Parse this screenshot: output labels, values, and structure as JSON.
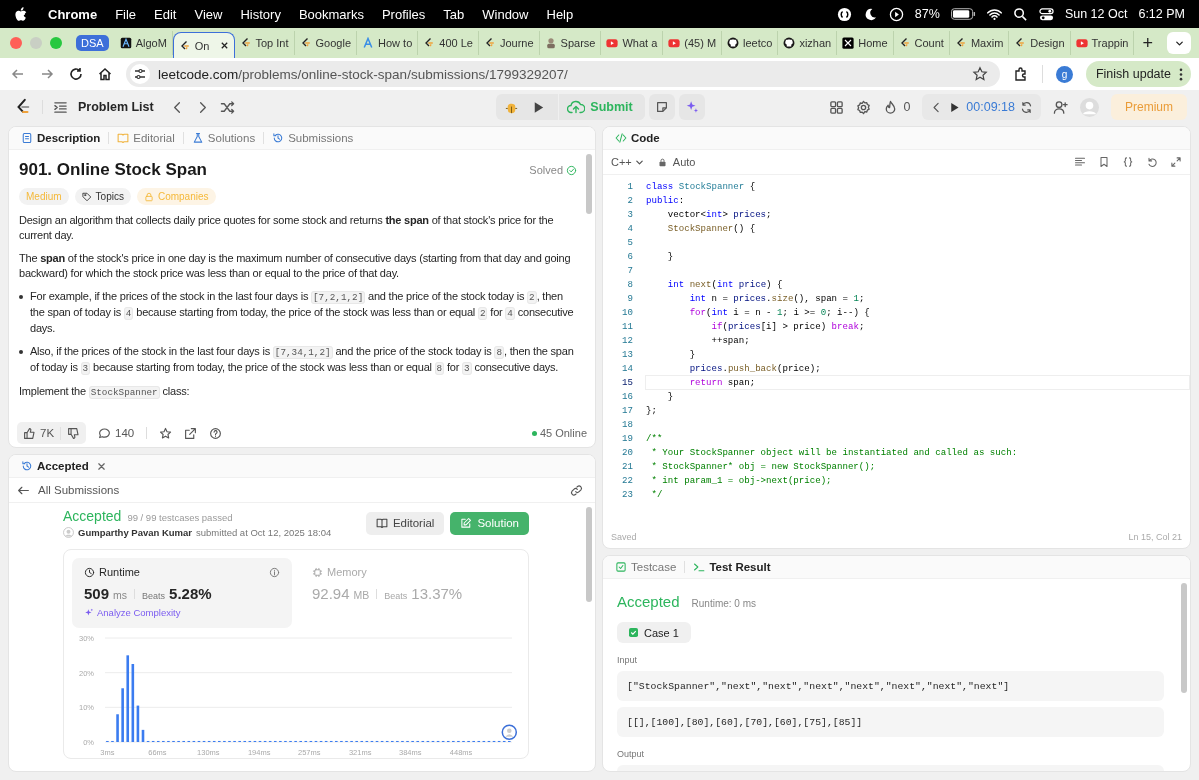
{
  "menu_bar": {
    "app": "Chrome",
    "items": [
      "File",
      "Edit",
      "View",
      "History",
      "Bookmarks",
      "Profiles",
      "Tab",
      "Window",
      "Help"
    ],
    "battery": "87%",
    "date": "Sun 12 Oct",
    "time": "6:12 PM"
  },
  "browser": {
    "group": "DSA",
    "tabs": [
      {
        "kind": "algo",
        "title": "AlgoM",
        "selected": false
      },
      {
        "kind": "leetcode",
        "title": "On",
        "selected": true
      },
      {
        "kind": "leetcode",
        "title": "Top Int",
        "selected": false
      },
      {
        "kind": "leetcode",
        "title": "Google",
        "selected": false
      },
      {
        "kind": "letter",
        "title": "How to",
        "selected": false
      },
      {
        "kind": "leetcode",
        "title": "400 Le",
        "selected": false
      },
      {
        "kind": "leetcode",
        "title": "Journe",
        "selected": false
      },
      {
        "kind": "person",
        "title": "Sparse",
        "selected": false
      },
      {
        "kind": "video",
        "title": "What a",
        "selected": false
      },
      {
        "kind": "video",
        "title": "(45) M",
        "selected": false
      },
      {
        "kind": "octocat",
        "title": "leetco",
        "selected": false
      },
      {
        "kind": "octocat",
        "title": "xizhan",
        "selected": false
      },
      {
        "kind": "cross",
        "title": "Home",
        "selected": false
      },
      {
        "kind": "leetcode",
        "title": "Count",
        "selected": false
      },
      {
        "kind": "leetcode",
        "title": "Maxim",
        "selected": false
      },
      {
        "kind": "leetcode",
        "title": "Design",
        "selected": false
      },
      {
        "kind": "video",
        "title": "Trappin",
        "selected": false
      }
    ],
    "new_tab": "+",
    "address": {
      "host": "leetcode.com",
      "path": "/problems/online-stock-span/submissions/1799329207/"
    },
    "profile": "g",
    "update_button": "Finish update"
  },
  "header": {
    "problem_list": "Problem List",
    "submit": "Submit",
    "streak": "0",
    "timer": "00:09:18",
    "premium": "Premium"
  },
  "description_panel": {
    "tabs": [
      {
        "label": "Description",
        "selected": true
      },
      {
        "label": "Editorial",
        "selected": false
      },
      {
        "label": "Solutions",
        "selected": false
      },
      {
        "label": "Submissions",
        "selected": false
      }
    ],
    "title": "901. Online Stock Span",
    "status": "Solved",
    "difficulty": "Medium",
    "tags": [
      {
        "kind": "topics",
        "label": "Topics"
      },
      {
        "kind": "locked",
        "label": "Companies"
      }
    ],
    "paragraphs": [
      {
        "kind": "text",
        "segments": [
          {
            "kind": "text",
            "text": "Design an algorithm that collects daily price quotes for some stock and returns **the span** of that stock's price for the current day."
          }
        ]
      },
      {
        "kind": "text",
        "segments": [
          {
            "kind": "text",
            "text": "The **span** of the stock's price in one day is the maximum number of consecutive days (starting from that day and going backward) for which the stock price was less than or equal to the price of that day."
          }
        ]
      },
      {
        "kind": "bullet",
        "segments": [
          {
            "kind": "text",
            "text": "For example, if the prices of the stock in the last four days is "
          },
          {
            "kind": "code",
            "text": "[7,2,1,2]"
          },
          {
            "kind": "text",
            "text": " and the price of the stock today is "
          },
          {
            "kind": "code",
            "text": "2"
          },
          {
            "kind": "text",
            "text": ", then the span of today is "
          },
          {
            "kind": "code",
            "text": "4"
          },
          {
            "kind": "text",
            "text": " because starting from today, the price of the stock was less than or equal "
          },
          {
            "kind": "code",
            "text": "2"
          },
          {
            "kind": "text",
            "text": " for "
          },
          {
            "kind": "code",
            "text": "4"
          },
          {
            "kind": "text",
            "text": " consecutive days."
          }
        ]
      },
      {
        "kind": "bullet",
        "segments": [
          {
            "kind": "text",
            "text": "Also, if the prices of the stock in the last four days is "
          },
          {
            "kind": "code",
            "text": "[7,34,1,2]"
          },
          {
            "kind": "text",
            "text": " and the price of the stock today is "
          },
          {
            "kind": "code",
            "text": "8"
          },
          {
            "kind": "text",
            "text": ", then the span of today is "
          },
          {
            "kind": "code",
            "text": "3"
          },
          {
            "kind": "text",
            "text": " because starting from today, the price of the stock was less than or equal "
          },
          {
            "kind": "code",
            "text": "8"
          },
          {
            "kind": "text",
            "text": " for "
          },
          {
            "kind": "code",
            "text": "3"
          },
          {
            "kind": "text",
            "text": " consecutive days."
          }
        ]
      },
      {
        "kind": "text",
        "segments": [
          {
            "kind": "text",
            "text": "Implement the "
          },
          {
            "kind": "code",
            "text": "StockSpanner"
          },
          {
            "kind": "text",
            "text": " class:"
          }
        ]
      }
    ],
    "likes": "7K",
    "comments": "140",
    "online": "45 Online"
  },
  "submission_panel": {
    "tab": "Accepted",
    "back_link": "All Submissions",
    "status": "Accepted",
    "testcases": "99 / 99 testcases passed",
    "author": "Gumparthy Pavan Kumar",
    "submitted": "submitted at Oct 12, 2025 18:04",
    "buttons": [
      {
        "kind": "secondary",
        "label": "Editorial"
      },
      {
        "kind": "primary",
        "label": "Solution"
      }
    ],
    "stats": [
      {
        "kind": "runtime",
        "label": "Runtime",
        "value": "509",
        "unit": "ms",
        "beats_label": "Beats",
        "beats": "5.28%",
        "action": "Analyze Complexity",
        "selected": true
      },
      {
        "kind": "memory",
        "label": "Memory",
        "value": "92.94",
        "unit": "MB",
        "beats_label": "Beats",
        "beats": "13.37%",
        "selected": false
      }
    ],
    "chart_data": {
      "type": "bar",
      "ylim": [
        0,
        30
      ],
      "xlim": [
        0,
        512
      ],
      "x": [
        3,
        9.4,
        15.8,
        22.2,
        28.6,
        35,
        41.4,
        47.8,
        54.2,
        60.6,
        67,
        73.4,
        79.8,
        86.2,
        92.6,
        99,
        105.4,
        111.8,
        118.2,
        124.6,
        131,
        137.4,
        143.8,
        150.2,
        156.6,
        163,
        169.4,
        175.8,
        182.2,
        188.6,
        195,
        201.4,
        207.8,
        214.2,
        220.6,
        227,
        233.4,
        239.8,
        246.2,
        252.6,
        259,
        265.4,
        271.8,
        278.2,
        284.6,
        291,
        297.4,
        303.8,
        310.2,
        316.6,
        323,
        329.4,
        335.8,
        342.2,
        348.6,
        355,
        361.4,
        367.8,
        374.2,
        380.6,
        387,
        393.4,
        399.8,
        406.2,
        412.6,
        419,
        425.4,
        431.8,
        438.2,
        444.6,
        451,
        457.4,
        463.8,
        470.2,
        476.6,
        483,
        489.4,
        495.8,
        502.2,
        508.6
      ],
      "values": [
        0.3,
        0.3,
        8,
        15.5,
        25,
        22.5,
        10.5,
        3.5,
        0.3,
        0.3,
        0.3,
        0.3,
        0.3,
        0.3,
        0.3,
        0.3,
        0.3,
        0.3,
        0.3,
        0.3,
        0.3,
        0.3,
        0.3,
        0.3,
        0.3,
        0.3,
        0.3,
        0.3,
        0.3,
        0.3,
        0.3,
        0.3,
        0.3,
        0.3,
        0.3,
        0.3,
        0.3,
        0.3,
        0.3,
        0.3,
        0.3,
        0.3,
        0.3,
        0.3,
        0.3,
        0.3,
        0.3,
        0.3,
        0.3,
        0.3,
        0.3,
        0.3,
        0.3,
        0.3,
        0.3,
        0.3,
        0.3,
        0.3,
        0.3,
        0.3,
        0.3,
        0.3,
        0.3,
        0.3,
        0.3,
        0.3,
        0.3,
        0.3,
        0.3,
        0.3,
        0.3,
        0.3,
        0.3,
        0.3,
        0.3,
        0.3,
        0.3,
        0.3,
        0.3,
        0.3
      ],
      "xticks": [
        {
          "value": 3,
          "label": "3ms"
        },
        {
          "value": 66,
          "label": "66ms"
        },
        {
          "value": 130,
          "label": "130ms"
        },
        {
          "value": 194,
          "label": "194ms"
        },
        {
          "value": 257,
          "label": "257ms"
        },
        {
          "value": 321,
          "label": "321ms"
        },
        {
          "value": 384,
          "label": "384ms"
        },
        {
          "value": 448,
          "label": "448ms"
        }
      ],
      "yticks": [
        {
          "value": 0,
          "label": "0%"
        },
        {
          "value": 10,
          "label": "10%"
        },
        {
          "value": 20,
          "label": "20%"
        },
        {
          "value": 30,
          "label": "30%"
        }
      ]
    }
  },
  "editor": {
    "title": "Code",
    "language": "C++",
    "mode": "Auto",
    "lines": [
      {
        "number": "1",
        "active": false,
        "tokens": [
          {
            "kind": "keyword",
            "text": "class"
          },
          {
            "kind": "type",
            "text": " StockSpanner"
          },
          {
            "kind": "plain",
            "text": " {"
          }
        ]
      },
      {
        "number": "2",
        "active": false,
        "tokens": [
          {
            "kind": "keyword",
            "text": "public"
          },
          {
            "kind": "plain",
            "text": ":"
          }
        ]
      },
      {
        "number": "3",
        "active": false,
        "tokens": [
          {
            "kind": "plain",
            "text": "    vector<"
          },
          {
            "kind": "keyword",
            "text": "int"
          },
          {
            "kind": "plain",
            "text": "> "
          },
          {
            "kind": "variable",
            "text": "prices"
          },
          {
            "kind": "plain",
            "text": ";"
          }
        ]
      },
      {
        "number": "4",
        "active": false,
        "tokens": [
          {
            "kind": "func",
            "text": "    StockSpanner"
          },
          {
            "kind": "plain",
            "text": "() {"
          }
        ]
      },
      {
        "number": "5",
        "active": false
      },
      {
        "number": "6",
        "active": false,
        "tokens": [
          {
            "kind": "plain",
            "text": "    }"
          }
        ]
      },
      {
        "number": "7",
        "active": false
      },
      {
        "number": "8",
        "active": false,
        "tokens": [
          {
            "kind": "keyword",
            "text": "    int"
          },
          {
            "kind": "func",
            "text": " next"
          },
          {
            "kind": "plain",
            "text": "("
          },
          {
            "kind": "keyword",
            "text": "int"
          },
          {
            "kind": "variable",
            "text": " price"
          },
          {
            "kind": "plain",
            "text": ") {"
          }
        ]
      },
      {
        "number": "9",
        "active": false,
        "tokens": [
          {
            "kind": "keyword",
            "text": "        int"
          },
          {
            "kind": "plain",
            "text": " n = "
          },
          {
            "kind": "variable",
            "text": "prices"
          },
          {
            "kind": "plain",
            "text": "."
          },
          {
            "kind": "func",
            "text": "size"
          },
          {
            "kind": "plain",
            "text": "(), span = "
          },
          {
            "kind": "number",
            "text": "1"
          },
          {
            "kind": "plain",
            "text": ";"
          }
        ]
      },
      {
        "number": "10",
        "active": false,
        "tokens": [
          {
            "kind": "control",
            "text": "        for"
          },
          {
            "kind": "plain",
            "text": "("
          },
          {
            "kind": "keyword",
            "text": "int"
          },
          {
            "kind": "plain",
            "text": " i = n - "
          },
          {
            "kind": "number",
            "text": "1"
          },
          {
            "kind": "plain",
            "text": "; i >= "
          },
          {
            "kind": "number",
            "text": "0"
          },
          {
            "kind": "plain",
            "text": "; i--) {"
          }
        ]
      },
      {
        "number": "11",
        "active": false,
        "tokens": [
          {
            "kind": "control",
            "text": "            if"
          },
          {
            "kind": "plain",
            "text": "("
          },
          {
            "kind": "variable",
            "text": "prices"
          },
          {
            "kind": "plain",
            "text": "[i] > price) "
          },
          {
            "kind": "control",
            "text": "break"
          },
          {
            "kind": "plain",
            "text": ";"
          }
        ]
      },
      {
        "number": "12",
        "active": false,
        "tokens": [
          {
            "kind": "plain",
            "text": "            ++span;"
          }
        ]
      },
      {
        "number": "13",
        "active": false,
        "tokens": [
          {
            "kind": "plain",
            "text": "        }"
          }
        ]
      },
      {
        "number": "14",
        "active": false,
        "tokens": [
          {
            "kind": "variable",
            "text": "        prices"
          },
          {
            "kind": "plain",
            "text": "."
          },
          {
            "kind": "func",
            "text": "push_back"
          },
          {
            "kind": "plain",
            "text": "(price);"
          }
        ]
      },
      {
        "number": "15",
        "active": true,
        "tokens": [
          {
            "kind": "control",
            "text": "        return"
          },
          {
            "kind": "plain",
            "text": " span;"
          }
        ]
      },
      {
        "number": "16",
        "active": false,
        "tokens": [
          {
            "kind": "plain",
            "text": "    }"
          }
        ]
      },
      {
        "number": "17",
        "active": false,
        "tokens": [
          {
            "kind": "plain",
            "text": "};"
          }
        ]
      },
      {
        "number": "18",
        "active": false
      },
      {
        "number": "19",
        "active": false,
        "tokens": [
          {
            "kind": "comment",
            "text": "/**"
          }
        ]
      },
      {
        "number": "20",
        "active": false,
        "tokens": [
          {
            "kind": "comment",
            "text": " * Your StockSpanner object will be instantiated and called as such:"
          }
        ]
      },
      {
        "number": "21",
        "active": false,
        "tokens": [
          {
            "kind": "comment",
            "text": " * StockSpanner* obj = new StockSpanner();"
          }
        ]
      },
      {
        "number": "22",
        "active": false,
        "tokens": [
          {
            "kind": "comment",
            "text": " * int param_1 = obj->next(price);"
          }
        ]
      },
      {
        "number": "23",
        "active": false,
        "tokens": [
          {
            "kind": "comment",
            "text": " */"
          }
        ]
      }
    ],
    "status": "Saved",
    "cursor": "Ln 15, Col 21"
  },
  "result_panel": {
    "tabs": [
      {
        "kind": "testcase",
        "label": "Testcase",
        "selected": false
      },
      {
        "kind": "result",
        "label": "Test Result",
        "selected": true
      }
    ],
    "verdict": "Accepted",
    "runtime": "Runtime: 0 ms",
    "cases": [
      {
        "label": "Case 1",
        "selected": true
      }
    ],
    "input_label": "Input",
    "inputs": [
      "[\"StockSpanner\",\"next\",\"next\",\"next\",\"next\",\"next\",\"next\",\"next\"]",
      "[[],[100],[80],[60],[70],[60],[75],[85]]"
    ],
    "output_label": "Output"
  }
}
